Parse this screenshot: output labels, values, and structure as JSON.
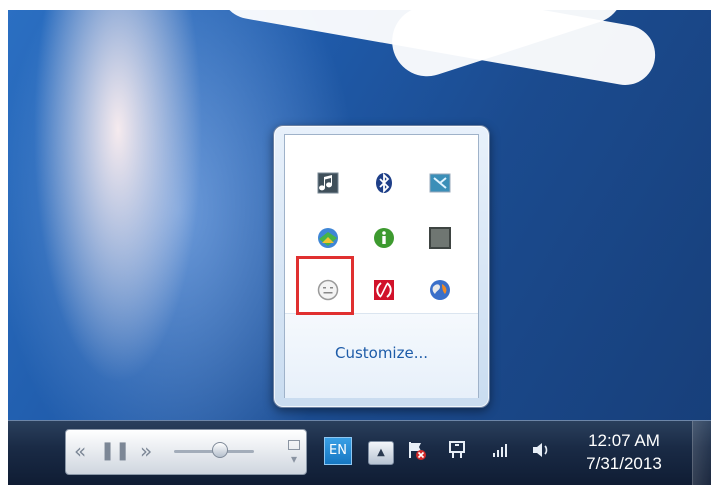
{
  "tray_overflow": {
    "customize_label": "Customize...",
    "icons": [
      {
        "name": "music-player-icon"
      },
      {
        "name": "bluetooth-icon"
      },
      {
        "name": "remote-display-icon"
      },
      {
        "name": "download-manager-icon"
      },
      {
        "name": "info-icon"
      },
      {
        "name": "gray-square-icon"
      },
      {
        "name": "smiley-status-icon"
      },
      {
        "name": "red-app-icon"
      },
      {
        "name": "globe-network-icon"
      }
    ]
  },
  "media_player": {
    "prev_symbol": "«",
    "pause_symbol": "❚❚",
    "next_symbol": "»",
    "restore_symbol": "▾"
  },
  "taskbar": {
    "language": "EN",
    "show_hidden_symbol": "▲",
    "time": "12:07 AM",
    "date": "7/31/2013"
  },
  "colors": {
    "highlight": "#e03030",
    "link": "#1d5ba8",
    "taskbar": "#1a2b46"
  }
}
